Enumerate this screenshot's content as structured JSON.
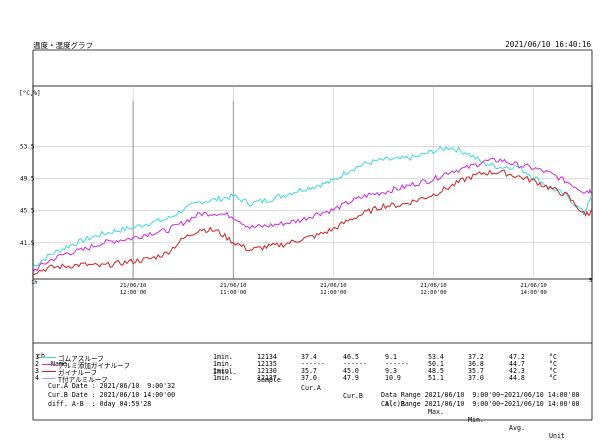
{
  "header": {
    "title": "温度・湿度グラフ",
    "datetime": "2021/06/10 16:40:16"
  },
  "chart_data": {
    "type": "line",
    "unit_label": "[°C,%]",
    "ylim": [
      37.0,
      61.0
    ],
    "y_ticks": [
      {
        "value": 41.5,
        "label": "41.5"
      },
      {
        "value": 45.5,
        "label": "45.5"
      },
      {
        "value": 49.5,
        "label": "49.5"
      },
      {
        "value": 53.5,
        "label": "53.5"
      }
    ],
    "x_start_label": "1h",
    "x_end_label": "5",
    "xlim": [
      0,
      335
    ],
    "x_ticks": [
      {
        "x": 60,
        "date": "21/06/10",
        "time": "12:00'00"
      },
      {
        "x": 120,
        "date": "21/06/10",
        "time": "11:00'00"
      },
      {
        "x": 180,
        "date": "21/06/10",
        "time": "12:00'00"
      },
      {
        "x": 240,
        "date": "21/06/10",
        "time": "12:00'00"
      },
      {
        "x": 300,
        "date": "21/06/10",
        "time": "14:00'00"
      }
    ],
    "cursors": [
      60,
      120
    ],
    "grid": true,
    "series": [
      {
        "name": "ゴムアスルーフ",
        "color": "#3fd8d8",
        "x": [
          0,
          10,
          20,
          30,
          40,
          50,
          60,
          70,
          80,
          90,
          100,
          110,
          120,
          130,
          140,
          150,
          160,
          170,
          180,
          190,
          200,
          210,
          220,
          230,
          240,
          250,
          260,
          270,
          280,
          290,
          300,
          310,
          320,
          330,
          335
        ],
        "y": [
          38.5,
          40.0,
          41.0,
          41.8,
          42.5,
          43.0,
          43.4,
          44.0,
          44.4,
          45.6,
          46.6,
          46.9,
          47.3,
          46.4,
          46.8,
          47.4,
          48.1,
          48.6,
          49.2,
          50.6,
          51.4,
          51.8,
          51.9,
          52.2,
          52.9,
          53.4,
          52.7,
          51.4,
          50.9,
          51.0,
          49.7,
          48.4,
          47.3,
          45.2,
          47.2
        ]
      },
      {
        "name": "アルミ添加ガイナルーフ",
        "color": "#c42dd8",
        "x": [
          0,
          10,
          20,
          30,
          40,
          50,
          60,
          70,
          80,
          90,
          100,
          110,
          120,
          130,
          140,
          150,
          160,
          170,
          180,
          190,
          200,
          210,
          220,
          230,
          240,
          250,
          260,
          270,
          280,
          290,
          300,
          310,
          320,
          330,
          335
        ],
        "y": [
          38.0,
          39.3,
          40.2,
          40.6,
          41.4,
          41.8,
          42.1,
          42.7,
          43.0,
          44.0,
          45.1,
          45.2,
          44.8,
          43.4,
          43.6,
          43.9,
          44.3,
          45.1,
          45.6,
          46.6,
          47.4,
          47.8,
          48.3,
          48.9,
          49.4,
          50.4,
          50.8,
          51.6,
          51.8,
          51.2,
          50.8,
          50.1,
          49.1,
          47.9,
          48.0
        ]
      },
      {
        "name": "ガイナルーフ",
        "color": "#cc2222",
        "x": [
          0,
          10,
          20,
          30,
          40,
          50,
          60,
          70,
          80,
          90,
          100,
          110,
          120,
          130,
          140,
          150,
          160,
          170,
          180,
          190,
          200,
          210,
          220,
          230,
          240,
          250,
          260,
          270,
          280,
          290,
          300,
          310,
          320,
          330,
          335
        ],
        "y": [
          37.8,
          38.4,
          38.6,
          38.8,
          38.6,
          38.9,
          39.2,
          39.5,
          40.2,
          42.0,
          43.2,
          43.0,
          41.6,
          40.6,
          41.0,
          41.3,
          41.9,
          42.4,
          43.2,
          44.4,
          45.3,
          46.1,
          46.2,
          46.8,
          47.5,
          48.5,
          49.5,
          50.2,
          50.3,
          49.8,
          49.2,
          48.3,
          47.4,
          45.1,
          45.3
        ]
      },
      {
        "name": "T付アルミルーフ",
        "color": "#a8a8d8",
        "x": [],
        "y": []
      }
    ]
  },
  "table": {
    "headers": {
      "ch": "ch",
      "name": "Name",
      "intvl": "Intvl.",
      "sample": "Sample",
      "cura": "Cur.A",
      "curb": "Cur.B",
      "ab": "A(-)B",
      "max": "Max.",
      "min": "Min.",
      "avg": "Avg.",
      "unit": "Unit"
    },
    "rows": [
      {
        "ch": "1",
        "name": "ゴムアスルーフ",
        "intvl": "1min.",
        "sample": "12134",
        "cura": "37.4",
        "curb": "46.5",
        "ab": "9.1",
        "max": "53.4",
        "min": "37.2",
        "avg": "47.2",
        "unit": "°C"
      },
      {
        "ch": "2",
        "name": "アルミ添加ガイナルーフ",
        "intvl": "1min.",
        "sample": "12135",
        "cura": "------",
        "curb": "------",
        "ab": "------",
        "max": "50.1",
        "min": "36.8",
        "avg": "44.7",
        "unit": "°C"
      },
      {
        "ch": "3",
        "name": "ガイナルーフ",
        "intvl": "1min.",
        "sample": "12130",
        "cura": "35.7",
        "curb": "45.0",
        "ab": "9.3",
        "max": "48.5",
        "min": "35.7",
        "avg": "42.3",
        "unit": "°C"
      },
      {
        "ch": "4",
        "name": "T付アルミルーフ",
        "intvl": "1min.",
        "sample": "12137",
        "cura": "37.0",
        "curb": "47.9",
        "ab": "10.9",
        "max": "51.1",
        "min": "37.0",
        "avg": "44.8",
        "unit": "°C"
      }
    ]
  },
  "footer": {
    "cur_a_label": "Cur.A Date",
    "cur_a_value": ": 2021/06/10  9:00'32",
    "cur_b_label": "Cur.B Date",
    "cur_b_value": ": 2021/06/10 14:00'00",
    "diff_label": "diff. A-B",
    "diff_value": ": 0day 04:59'28",
    "data_range_label": "Data Range",
    "data_range_value": "2021/06/10  9:00'00~2021/06/10 14:00'00",
    "calc_range_label": "Calc Range",
    "calc_range_value": "2021/06/10  9:00'00~2021/06/10 14:00'00"
  }
}
